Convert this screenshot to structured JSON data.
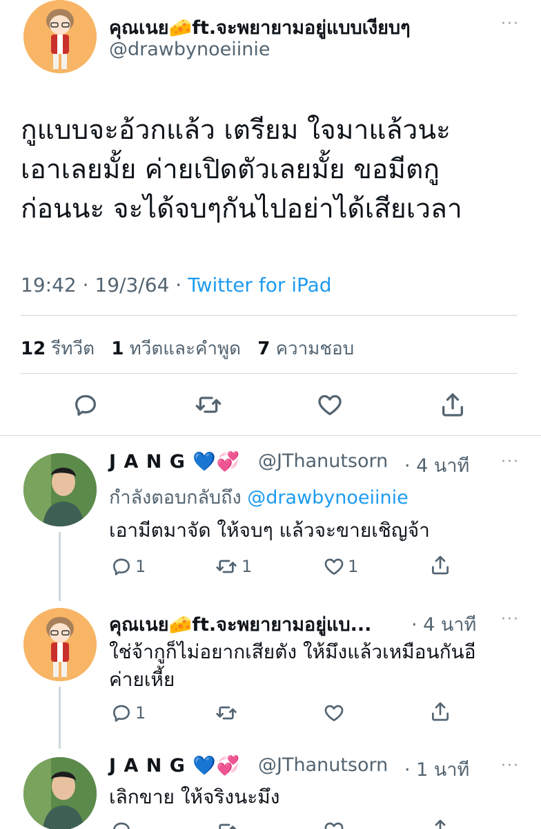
{
  "main_tweet": {
    "display_name": "คุณเนย🧀ft.จะพยายามอยู่แบบเงียบๆ",
    "handle": "@drawbynoeiinie",
    "text_lines": [
      "กูแบบจะอ้วกแล้ว เตรียม ใจมาแล้วนะ",
      "เอาเลยมั้ย ค่ายเปิดตัวเลยมั้ย ขอมีตกู",
      "ก่อนนะ จะได้จบๆกันไปอย่าได้เสียเวลา"
    ],
    "time": "19:42",
    "date": "19/3/64",
    "separator": "·",
    "source": "Twitter for iPad",
    "stats": {
      "retweets_count": "12",
      "retweets_label": "รีทวีต",
      "quotes_count": "1",
      "quotes_label": "ทวีตและคำพูด",
      "likes_count": "7",
      "likes_label": "ความชอบ"
    }
  },
  "replies": [
    {
      "display_name": "J A N G 💙💞",
      "handle": "@JThanutsorn",
      "time": "· 4 นาที",
      "reply_to_label": "กำลังตอบกลับถึง",
      "reply_to_handle": "@drawbynoeiinie",
      "text_lines": [
        "เอามีตมาจัด ให้จบๆ แล้วจะขายเชิญจ้า"
      ],
      "counts": {
        "reply": "1",
        "retweet": "1",
        "like": "1"
      }
    },
    {
      "display_name": "คุณเนย🧀ft.จะพยายามอยู่แบ...",
      "time": "· 4 นาที",
      "text_lines": [
        "ใช่จ้ากูก็ไม่อยากเสียตัง ให้มึงแล้วเหมือนกันอี",
        "ค่ายเหี้ย"
      ],
      "counts": {
        "reply": "1"
      }
    },
    {
      "display_name": "J A N G 💙💞",
      "handle": "@JThanutsorn",
      "time": "· 1 นาที",
      "text_lines": [
        "เลิกขาย ให้จริงนะมึง"
      ]
    }
  ],
  "more_label": "···",
  "icons": [
    "reply-icon",
    "retweet-icon",
    "like-icon",
    "share-icon",
    "more-icon"
  ],
  "colors": {
    "link": "#1d9bf0",
    "secondary": "#536471",
    "divider": "#cfd9de"
  }
}
